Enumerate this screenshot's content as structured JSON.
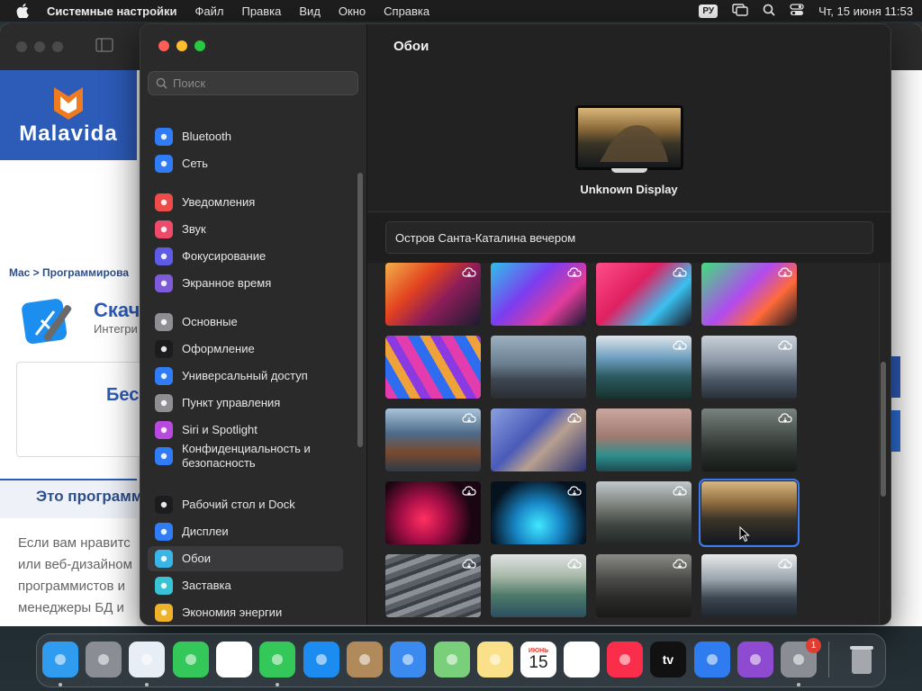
{
  "menubar": {
    "app_name": "Системные настройки",
    "items": [
      "Файл",
      "Правка",
      "Вид",
      "Окно",
      "Справка"
    ],
    "input_lang": "РУ",
    "datetime": "Чт, 15 июня  11:53"
  },
  "browser": {
    "site_logo": "Malavida",
    "breadcrumb": "Mac > Программирова",
    "heading_fragment": "Скач",
    "subtitle_fragment": "Интегри",
    "button_fragment": "Бес",
    "section_fragment": "Это программ",
    "body_fragment": [
      "Если вам нравитс",
      "или веб-дизайном",
      "программистов и",
      "менеджеры БД и"
    ]
  },
  "settings": {
    "search_placeholder": "Поиск",
    "sidebar": [
      {
        "label": "Bluetooth",
        "icon": "bluetooth-icon",
        "color": "#2f7cf6"
      },
      {
        "label": "Сеть",
        "icon": "globe-icon",
        "color": "#2f7cf6"
      },
      {
        "label": "Уведомления",
        "icon": "bell-icon",
        "color": "#ee4b4b"
      },
      {
        "label": "Звук",
        "icon": "speaker-icon",
        "color": "#ee4b6a"
      },
      {
        "label": "Фокусирование",
        "icon": "moon-icon",
        "color": "#5e5ce6"
      },
      {
        "label": "Экранное время",
        "icon": "hourglass-icon",
        "color": "#7d5bd9"
      },
      {
        "label": "Основные",
        "icon": "gear-icon",
        "color": "#8e8e93"
      },
      {
        "label": "Оформление",
        "icon": "appearance-icon",
        "color": "#1c1c1e"
      },
      {
        "label": "Универсальный доступ",
        "icon": "accessibility-icon",
        "color": "#2f7cf6"
      },
      {
        "label": "Пункт управления",
        "icon": "control-center-icon",
        "color": "#8e8e93"
      },
      {
        "label": "Siri и Spotlight",
        "icon": "siri-icon",
        "color": "#b84ae0"
      },
      {
        "label": "Конфиденциальность и безопасность",
        "icon": "hand-icon",
        "color": "#2f7cf6"
      },
      {
        "label": "Рабочий стол и Dock",
        "icon": "dock-icon",
        "color": "#1c1c1e"
      },
      {
        "label": "Дисплеи",
        "icon": "sun-icon",
        "color": "#2f7cf6"
      },
      {
        "label": "Обои",
        "icon": "wallpaper-icon",
        "color": "#38b6e8",
        "selected": true
      },
      {
        "label": "Заставка",
        "icon": "screensaver-icon",
        "color": "#38c3d6"
      },
      {
        "label": "Экономия энергии",
        "icon": "battery-icon",
        "color": "#f0b22a"
      },
      {
        "label": "Экран блокировки",
        "icon": "lock-icon",
        "color": "#1c1c1e"
      }
    ],
    "pane_title": "Обои",
    "display_name": "Unknown Display",
    "wallpaper_name": "Остров Санта-Каталина вечером",
    "wallpapers": [
      {
        "name": "macOS abstract orange",
        "g": "linear-gradient(135deg,#f3b04a 0%,#e2421f 35%,#8c1d5a 60%,#1b1b2e 100%)",
        "cloud": true
      },
      {
        "name": "macOS abstract blue",
        "g": "linear-gradient(135deg,#2fc1e8 0%,#7a3df0 40%,#e23c9a 70%,#101a2e 100%)",
        "cloud": true
      },
      {
        "name": "macOS abstract pink",
        "g": "linear-gradient(135deg,#ff4e8a 0%,#e02060 40%,#3ac0f0 70%,#1a1420 100%)",
        "cloud": true
      },
      {
        "name": "macOS abstract green",
        "g": "linear-gradient(135deg,#3ee07a 0%,#b14af0 45%,#ff6a3a 70%,#141a20 100%)",
        "cloud": true
      },
      {
        "name": "macOS pattern",
        "g": "repeating-linear-gradient(60deg,#e23cae 0 12px,#2f6df0 12px 24px,#f0a23a 24px 34px,#8a3ae0 34px 44px)",
        "cloud": false
      },
      {
        "name": "Mountains blue",
        "g": "linear-gradient(180deg,#9bb0c0 0%,#6b7f90 45%,#3d4650 70%,#2a2e33 100%)",
        "cloud": false
      },
      {
        "name": "Catalina coast",
        "g": "linear-gradient(180deg,#dfe6ea 0%,#6fa0c0 35%,#2c5a62 65%,#17322e 100%)",
        "cloud": true
      },
      {
        "name": "Rocks water",
        "g": "linear-gradient(180deg,#c8d0d8 0%,#8e9aa8 40%,#4c5866 70%,#2a3038 100%)",
        "cloud": true
      },
      {
        "name": "Catalina cliffs",
        "g": "linear-gradient(180deg,#a9c3da 0%,#4c6a88 40%,#7a4a2e 70%,#2c3a4a 100%)",
        "cloud": true
      },
      {
        "name": "Sea stack",
        "g": "linear-gradient(135deg,#8aa0e0 0%,#4a5ab8 40%,#b8a090 60%,#2a3070 100%)",
        "cloud": true
      },
      {
        "name": "Cliff colors",
        "g": "linear-gradient(180deg,#c9a7a0 0%,#a07a70 45%,#2e8e8c 75%,#1a4a50 100%)",
        "cloud": false
      },
      {
        "name": "Coast road",
        "g": "linear-gradient(180deg,#7a8280 0%,#4a524e 40%,#2a302c 70%,#161a18 100%)",
        "cloud": true
      },
      {
        "name": "Red plants",
        "g": "radial-gradient(circle at 40% 60%,#ff3060 0%,#b0104a 30%,#1a0612 70%)",
        "cloud": true
      },
      {
        "name": "Blue plants",
        "g": "radial-gradient(circle at 50% 70%,#40e8ff 0%,#1888c8 35%,#06121e 75%)",
        "cloud": true
      },
      {
        "name": "Mountains dusk",
        "g": "linear-gradient(180deg,#c0c8cc 0%,#7a7e78 40%,#3e4440 70%,#222826 100%)",
        "cloud": true
      },
      {
        "name": "Catalina evening",
        "g": "linear-gradient(180deg,#d8b680 0%,#8c6a3e 35%,#3a3428 60%,#141820 100%)",
        "cloud": false,
        "selected": true
      },
      {
        "name": "Rock layers",
        "g": "repeating-linear-gradient(160deg,#8a9096 0 6px,#5a6066 6px 12px,#3a4046 12px 16px)",
        "cloud": true
      },
      {
        "name": "Green coast",
        "g": "linear-gradient(180deg,#e0e4e4 0%,#a8b8a8 35%,#4e7a6a 65%,#2a5060 100%)",
        "cloud": true
      },
      {
        "name": "Foggy sea",
        "g": "linear-gradient(180deg,#8a8a86 0%,#4a4a48 40%,#2a2a28 70%,#1a1a18 100%)",
        "cloud": true
      },
      {
        "name": "Island clouds",
        "g": "linear-gradient(180deg,#e8eaec 0%,#9aa4ac 40%,#3c4650 70%,#1e262e 100%)",
        "cloud": true
      }
    ]
  },
  "dock": {
    "apps": [
      {
        "name": "finder-icon",
        "bg": "#2f9cf0"
      },
      {
        "name": "launchpad-icon",
        "bg": "#8a8e94"
      },
      {
        "name": "safari-icon",
        "bg": "#e8eef6"
      },
      {
        "name": "messages-icon",
        "bg": "#34c759"
      },
      {
        "name": "photos-icon",
        "bg": "#ffffff"
      },
      {
        "name": "facetime-icon",
        "bg": "#34c759"
      },
      {
        "name": "app-store-icon",
        "bg": "#1c8cf0"
      },
      {
        "name": "contacts-icon",
        "bg": "#b08a5a"
      },
      {
        "name": "mail-icon",
        "bg": "#3a8af0"
      },
      {
        "name": "maps-icon",
        "bg": "#7ad07a"
      },
      {
        "name": "notes-icon",
        "bg": "#fbe08a"
      },
      {
        "name": "calendar-icon",
        "bg": "#ffffff"
      },
      {
        "name": "reminders-icon",
        "bg": "#ffffff"
      },
      {
        "name": "music-icon",
        "bg": "#fa2e4a"
      },
      {
        "name": "tv-icon",
        "bg": "#111111"
      },
      {
        "name": "keynote-icon",
        "bg": "#2f7cf0"
      },
      {
        "name": "podcasts-icon",
        "bg": "#8e4ad0"
      },
      {
        "name": "system-settings-icon",
        "bg": "#8a8e94"
      },
      {
        "name": "trash-icon",
        "bg": "transparent"
      }
    ],
    "calendar_month": "ИЮНЬ",
    "calendar_day": "15",
    "tv_label": "tv",
    "settings_badge": "1"
  }
}
